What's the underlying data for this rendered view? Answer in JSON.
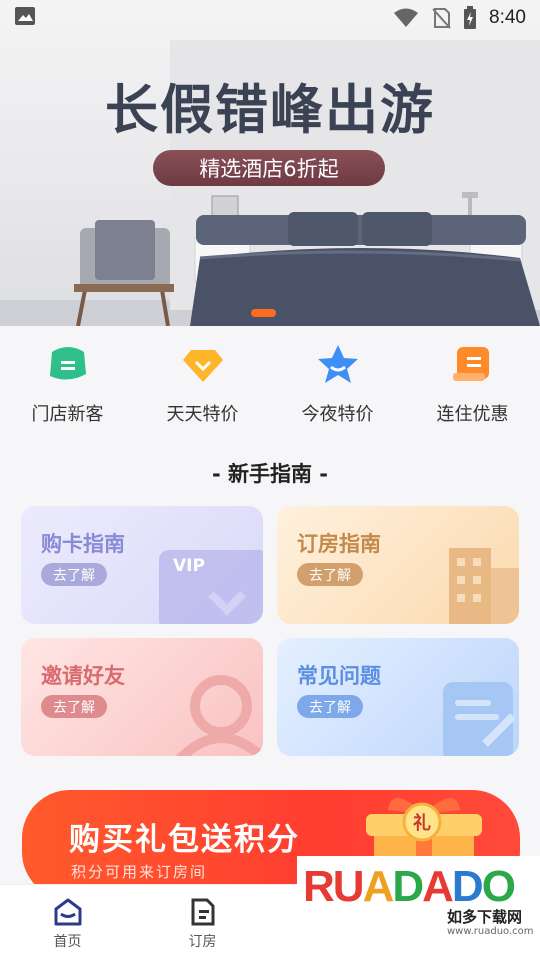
{
  "status_bar": {
    "time": "8:40"
  },
  "banner": {
    "title": "长假错峰出游",
    "subtitle": "精选酒店6折起",
    "accent": "#ff6a1e"
  },
  "quick_nav": [
    {
      "label": "门店新客",
      "icon": "store-new-customer-icon",
      "color": "#2fbf8a"
    },
    {
      "label": "天天特价",
      "icon": "daily-deal-diamond-icon",
      "color": "#ffb52a"
    },
    {
      "label": "今夜特价",
      "icon": "tonight-star-icon",
      "color": "#3e8ef7"
    },
    {
      "label": "连住优惠",
      "icon": "consecutive-stay-icon",
      "color": "#ff8a2a"
    }
  ],
  "guide": {
    "title": "- 新手指南 -",
    "cards": [
      {
        "title": "购卡指南",
        "button": "去了解",
        "deco_text": "VIP"
      },
      {
        "title": "订房指南",
        "button": "去了解"
      },
      {
        "title": "邀请好友",
        "button": "去了解"
      },
      {
        "title": "常见问题",
        "button": "去了解"
      }
    ]
  },
  "promo": {
    "title": "购买礼包送积分",
    "subtitle": "积分可用来订房间",
    "badge": "礼"
  },
  "bottom_nav": [
    {
      "label": "首页",
      "icon": "home-icon",
      "active": true
    },
    {
      "label": "订房",
      "icon": "booking-icon",
      "active": false
    }
  ],
  "watermark": {
    "word": "RUADADO",
    "cn": "如多下载网",
    "url": "www.ruaduo.com"
  }
}
